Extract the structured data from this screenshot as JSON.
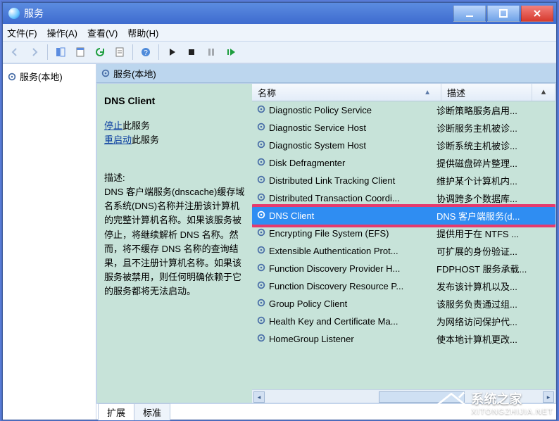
{
  "titlebar": {
    "title": "服务"
  },
  "menus": {
    "file": "文件(F)",
    "action": "操作(A)",
    "view": "查看(V)",
    "help": "帮助(H)"
  },
  "nav": {
    "root": "服务(本地)"
  },
  "mainhead": "服务(本地)",
  "detail": {
    "name": "DNS Client",
    "stop_pre": "停止",
    "stop_post": "此服务",
    "restart_pre": "重启动",
    "restart_post": "此服务",
    "desc_label": "描述:",
    "desc": "DNS 客户端服务(dnscache)缓存域名系统(DNS)名称并注册该计算机的完整计算机名称。如果该服务被停止，将继续解析 DNS 名称。然而，将不缓存 DNS 名称的查询结果，且不注册计算机名称。如果该服务被禁用，则任何明确依赖于它的服务都将无法启动。"
  },
  "columns": {
    "name": "名称",
    "desc": "描述"
  },
  "rows": [
    {
      "n": "Diagnostic Policy Service",
      "d": "诊断策略服务启用..."
    },
    {
      "n": "Diagnostic Service Host",
      "d": "诊断服务主机被诊..."
    },
    {
      "n": "Diagnostic System Host",
      "d": "诊断系统主机被诊..."
    },
    {
      "n": "Disk Defragmenter",
      "d": "提供磁盘碎片整理..."
    },
    {
      "n": "Distributed Link Tracking Client",
      "d": "维护某个计算机内..."
    },
    {
      "n": "Distributed Transaction Coordi...",
      "d": "协调跨多个数据库..."
    },
    {
      "n": "DNS Client",
      "d": "DNS 客户端服务(d...",
      "sel": true
    },
    {
      "n": "Encrypting File System (EFS)",
      "d": "提供用于在 NTFS ..."
    },
    {
      "n": "Extensible Authentication Prot...",
      "d": "可扩展的身份验证..."
    },
    {
      "n": "Function Discovery Provider H...",
      "d": "FDPHOST 服务承载..."
    },
    {
      "n": "Function Discovery Resource P...",
      "d": "发布该计算机以及..."
    },
    {
      "n": "Group Policy Client",
      "d": "该服务负责通过组..."
    },
    {
      "n": "Health Key and Certificate Ma...",
      "d": "为网络访问保护代..."
    },
    {
      "n": "HomeGroup Listener",
      "d": "使本地计算机更改..."
    }
  ],
  "tabs": {
    "ext": "扩展",
    "std": "标准"
  },
  "watermark": {
    "title": "系统之家",
    "sub": "XITONGZHIJIA.NET"
  }
}
